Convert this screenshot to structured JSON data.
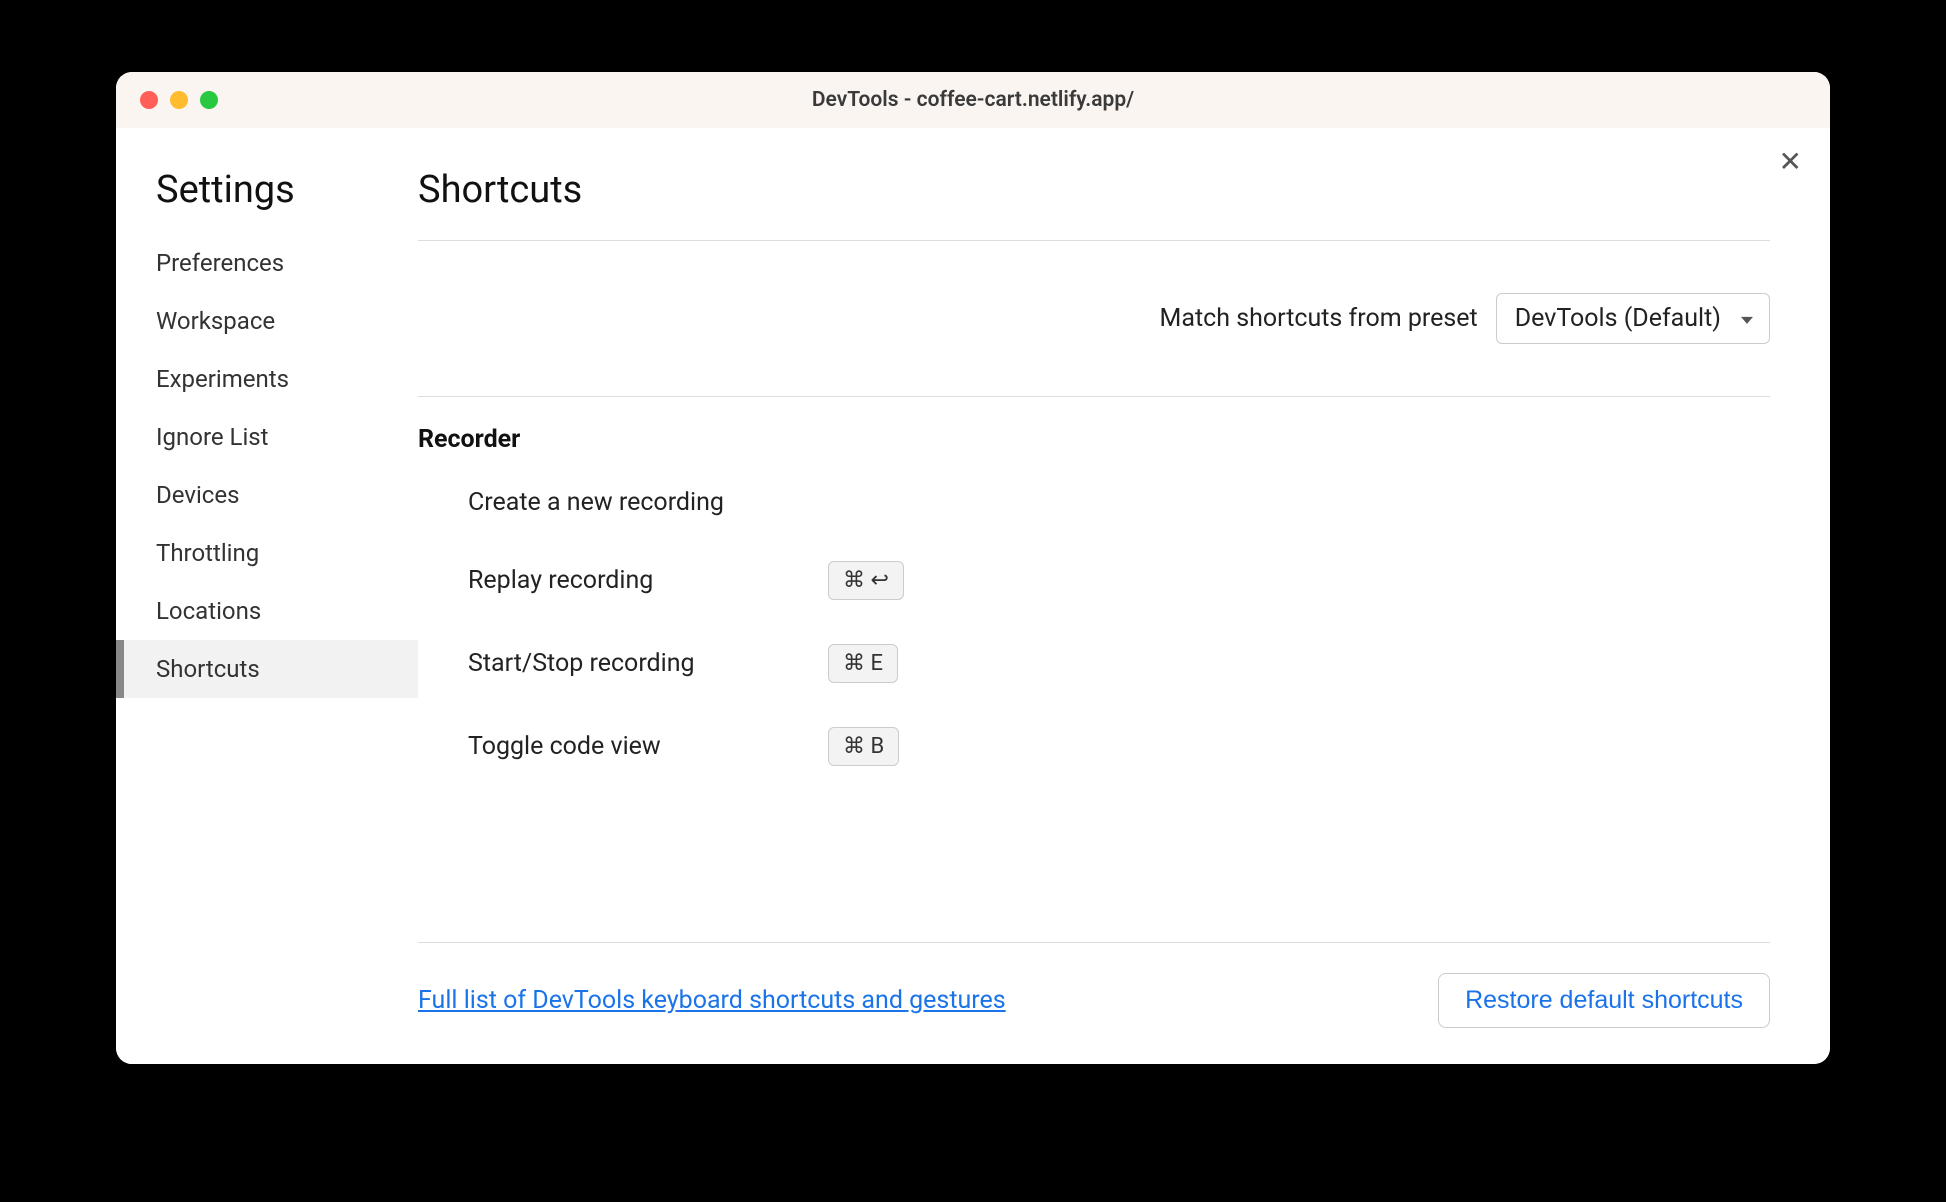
{
  "window": {
    "title": "DevTools - coffee-cart.netlify.app/"
  },
  "sidebar": {
    "title": "Settings",
    "items": [
      {
        "label": "Preferences"
      },
      {
        "label": "Workspace"
      },
      {
        "label": "Experiments"
      },
      {
        "label": "Ignore List"
      },
      {
        "label": "Devices"
      },
      {
        "label": "Throttling"
      },
      {
        "label": "Locations"
      },
      {
        "label": "Shortcuts"
      }
    ]
  },
  "main": {
    "title": "Shortcuts",
    "preset_label": "Match shortcuts from preset",
    "preset_value": "DevTools (Default)",
    "section": {
      "title": "Recorder",
      "rows": [
        {
          "label": "Create a new recording",
          "keys": ""
        },
        {
          "label": "Replay recording",
          "keys": "⌘  ↩"
        },
        {
          "label": "Start/Stop recording",
          "keys": "⌘  E"
        },
        {
          "label": "Toggle code view",
          "keys": "⌘  B"
        }
      ]
    },
    "footer_link": "Full list of DevTools keyboard shortcuts and gestures",
    "restore_button": "Restore default shortcuts"
  }
}
